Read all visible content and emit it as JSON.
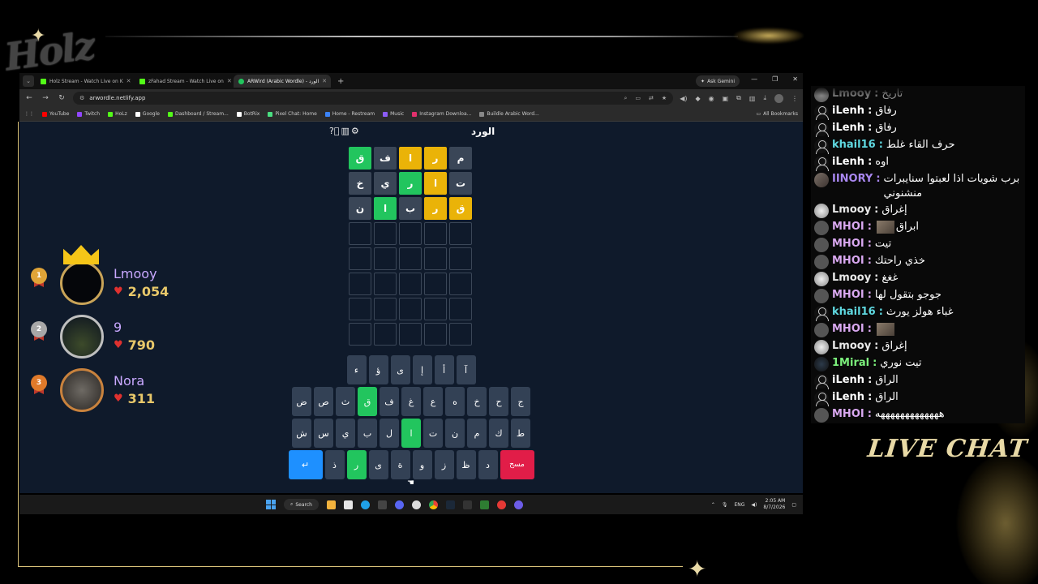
{
  "stream_overlay": {
    "logo_text": "Holz",
    "live_chat_label": "LIVE CHAT"
  },
  "browser": {
    "tabs": [
      {
        "title": "Holz Stream - Watch Live on K",
        "favicon_color": "#53fc18"
      },
      {
        "title": "zFahad Stream - Watch Live on",
        "favicon_color": "#53fc18"
      },
      {
        "title": "ARWird (Arabic Wordle) - الورد",
        "favicon_color": "#22c55e"
      }
    ],
    "ask_gemini_label": "Ask Gemini",
    "address": "arwordle.netlify.app",
    "bookmarks": [
      {
        "label": "YouTube",
        "color": "#ff0000"
      },
      {
        "label": "Twitch",
        "color": "#9146ff"
      },
      {
        "label": "HoLz",
        "color": "#53fc18"
      },
      {
        "label": "Google",
        "color": "#ffffff"
      },
      {
        "label": "Dashboard / Stream...",
        "color": "#53fc18"
      },
      {
        "label": "BotRix",
        "color": "#ffffff"
      },
      {
        "label": "Pixel Chat: Home",
        "color": "#4ade80"
      },
      {
        "label": "Home - Restream",
        "color": "#3b82f6"
      },
      {
        "label": "Music",
        "color": "#8b5cf6"
      },
      {
        "label": "Instagram Downloa...",
        "color": "#e1306c"
      },
      {
        "label": "Buildle Arabic Word...",
        "color": "#888888"
      }
    ],
    "all_bookmarks_label": "All Bookmarks"
  },
  "wordle": {
    "title": "الورد",
    "rows": [
      [
        {
          "l": "م",
          "s": "absent"
        },
        {
          "l": "ر",
          "s": "present"
        },
        {
          "l": "ا",
          "s": "present"
        },
        {
          "l": "ف",
          "s": "absent"
        },
        {
          "l": "ق",
          "s": "correct"
        }
      ],
      [
        {
          "l": "ت",
          "s": "absent"
        },
        {
          "l": "ا",
          "s": "present"
        },
        {
          "l": "ر",
          "s": "correct"
        },
        {
          "l": "ي",
          "s": "absent"
        },
        {
          "l": "خ",
          "s": "absent"
        }
      ],
      [
        {
          "l": "ق",
          "s": "present"
        },
        {
          "l": "ر",
          "s": "present"
        },
        {
          "l": "ب",
          "s": "absent"
        },
        {
          "l": "ا",
          "s": "correct"
        },
        {
          "l": "ن",
          "s": "absent"
        }
      ],
      [
        {
          "l": "",
          "s": "empty"
        },
        {
          "l": "",
          "s": "empty"
        },
        {
          "l": "",
          "s": "empty"
        },
        {
          "l": "",
          "s": "empty"
        },
        {
          "l": "",
          "s": "empty"
        }
      ],
      [
        {
          "l": "",
          "s": "empty"
        },
        {
          "l": "",
          "s": "empty"
        },
        {
          "l": "",
          "s": "empty"
        },
        {
          "l": "",
          "s": "empty"
        },
        {
          "l": "",
          "s": "empty"
        }
      ],
      [
        {
          "l": "",
          "s": "empty"
        },
        {
          "l": "",
          "s": "empty"
        },
        {
          "l": "",
          "s": "empty"
        },
        {
          "l": "",
          "s": "empty"
        },
        {
          "l": "",
          "s": "empty"
        }
      ],
      [
        {
          "l": "",
          "s": "empty"
        },
        {
          "l": "",
          "s": "empty"
        },
        {
          "l": "",
          "s": "empty"
        },
        {
          "l": "",
          "s": "empty"
        },
        {
          "l": "",
          "s": "empty"
        }
      ],
      [
        {
          "l": "",
          "s": "empty"
        },
        {
          "l": "",
          "s": "empty"
        },
        {
          "l": "",
          "s": "empty"
        },
        {
          "l": "",
          "s": "empty"
        },
        {
          "l": "",
          "s": "empty"
        }
      ]
    ],
    "keyboard": [
      [
        {
          "k": "آ"
        },
        {
          "k": "أ"
        },
        {
          "k": "إ"
        },
        {
          "k": "ى"
        },
        {
          "k": "ؤ"
        },
        {
          "k": "ء"
        }
      ],
      [
        {
          "k": "ج"
        },
        {
          "k": "ح"
        },
        {
          "k": "خ"
        },
        {
          "k": "ه"
        },
        {
          "k": "ع"
        },
        {
          "k": "غ"
        },
        {
          "k": "ف"
        },
        {
          "k": "ق",
          "s": "correct"
        },
        {
          "k": "ث"
        },
        {
          "k": "ص"
        },
        {
          "k": "ض"
        }
      ],
      [
        {
          "k": "ط"
        },
        {
          "k": "ك"
        },
        {
          "k": "م"
        },
        {
          "k": "ن"
        },
        {
          "k": "ت"
        },
        {
          "k": "ا",
          "s": "correct"
        },
        {
          "k": "ل"
        },
        {
          "k": "ب"
        },
        {
          "k": "ي"
        },
        {
          "k": "س"
        },
        {
          "k": "ش"
        }
      ],
      [
        {
          "k": "مسح",
          "t": "delete"
        },
        {
          "k": "د"
        },
        {
          "k": "ظ"
        },
        {
          "k": "ز"
        },
        {
          "k": "و"
        },
        {
          "k": "ة"
        },
        {
          "k": "ى"
        },
        {
          "k": "ر",
          "s": "correct"
        },
        {
          "k": "ذ"
        },
        {
          "k": "↵",
          "t": "enter"
        }
      ]
    ]
  },
  "leaderboard": [
    {
      "rank": "1",
      "name": "Lmooy",
      "score": "2,054",
      "name_color": "#c9a8ff",
      "medal_color": "#e0a437"
    },
    {
      "rank": "2",
      "name": "9",
      "score": "790",
      "name_color": "#c9a8ff",
      "medal_color": "#a8a8a8"
    },
    {
      "rank": "3",
      "name": "Nora",
      "score": "311",
      "name_color": "#c9a8ff",
      "medal_color": "#e07a2a"
    }
  ],
  "taskbar": {
    "search_label": "Search",
    "lang": "ENG",
    "time": "2:05 AM",
    "date": "8/7/2026"
  },
  "chat": [
    {
      "user": "Lmooy",
      "color": "#cfcfcf",
      "badge": "silver",
      "text": "تاريخ",
      "faded": true
    },
    {
      "user": "iLenh",
      "color": "#ffffff",
      "badge": "person",
      "text": "رفاق"
    },
    {
      "user": "iLenh",
      "color": "#ffffff",
      "badge": "person",
      "text": "رفاق"
    },
    {
      "user": "khail16",
      "color": "#5fd8e0",
      "badge": "person",
      "text": "حرف القاء غلط"
    },
    {
      "user": "iLenh",
      "color": "#ffffff",
      "badge": "person",
      "text": "اوه"
    },
    {
      "user": "IINORY",
      "color": "#a987f0",
      "badge": "purp",
      "text": "برب شويات اذا لعبتوا سنايبرات منشنوني"
    },
    {
      "user": "Lmooy",
      "color": "#e8e8e8",
      "badge": "silver",
      "text": "إغراق"
    },
    {
      "user": "MHOI",
      "color": "#d9a8f0",
      "badge": "bird",
      "text": "ابراق",
      "emote": true
    },
    {
      "user": "MHOI",
      "color": "#d9a8f0",
      "badge": "bird",
      "text": "تيت"
    },
    {
      "user": "MHOI",
      "color": "#d9a8f0",
      "badge": "bird",
      "text": "خذي راحتك"
    },
    {
      "user": "Lmooy",
      "color": "#e8e8e8",
      "badge": "silver",
      "text": "غغغ"
    },
    {
      "user": "MHOI",
      "color": "#d9a8f0",
      "badge": "bird",
      "text": "جوجو بتقول لها"
    },
    {
      "user": "khail16",
      "color": "#5fd8e0",
      "badge": "person",
      "text": "غباء هولز يورث"
    },
    {
      "user": "MHOI",
      "color": "#d9a8f0",
      "badge": "bird",
      "text": "",
      "emote": true
    },
    {
      "user": "Lmooy",
      "color": "#e8e8e8",
      "badge": "silver",
      "text": "إغراق"
    },
    {
      "user": "1Miral",
      "color": "#7cf07c",
      "badge": "dark",
      "text": "تيت نوري"
    },
    {
      "user": "iLenh",
      "color": "#ffffff",
      "badge": "person",
      "text": "الراق"
    },
    {
      "user": "iLenh",
      "color": "#ffffff",
      "badge": "person",
      "text": "الراق"
    },
    {
      "user": "MHOI",
      "color": "#d9a8f0",
      "badge": "bird",
      "text": "هههههههههههههه"
    }
  ]
}
